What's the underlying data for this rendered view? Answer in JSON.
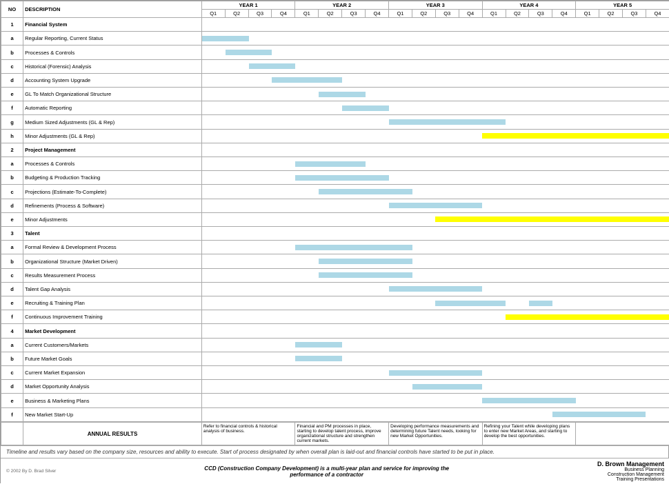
{
  "years": [
    "YEAR 1",
    "YEAR 2",
    "YEAR 3",
    "YEAR 4",
    "YEAR 5"
  ],
  "quarters": [
    "Q1",
    "Q2",
    "Q3",
    "Q4"
  ],
  "columns": {
    "no_label": "NO",
    "desc_label": "DESCRIPTION"
  },
  "sections": [
    {
      "no": "1",
      "title": "Financial System",
      "items": [
        {
          "id": "a",
          "desc": "Regular Reporting, Current Status",
          "bars": [
            {
              "q": 1,
              "w": 2,
              "color": "blue"
            }
          ]
        },
        {
          "id": "b",
          "desc": "Processes & Controls",
          "bars": [
            {
              "q": 2,
              "w": 2,
              "color": "blue"
            }
          ]
        },
        {
          "id": "c",
          "desc": "Historical (Forensic) Analysis",
          "bars": [
            {
              "q": 3,
              "w": 2,
              "color": "blue"
            }
          ]
        },
        {
          "id": "d",
          "desc": "Accounting System Upgrade",
          "bars": [
            {
              "q": 4,
              "w": 3,
              "color": "blue"
            }
          ]
        },
        {
          "id": "e",
          "desc": "GL To Match Organizational Structure",
          "bars": [
            {
              "q": 6,
              "w": 2,
              "color": "blue"
            }
          ]
        },
        {
          "id": "f",
          "desc": "Automatic Reporting",
          "bars": [
            {
              "q": 7,
              "w": 2,
              "color": "blue"
            }
          ]
        },
        {
          "id": "g",
          "desc": "Medium Sized Adjustments (GL & Rep)",
          "bars": [
            {
              "q": 9,
              "w": 5,
              "color": "blue"
            }
          ]
        },
        {
          "id": "h",
          "desc": "Minor Adjustments (GL & Rep)",
          "bars": [
            {
              "q": 13,
              "w": 8,
              "color": "yellow"
            }
          ]
        }
      ]
    },
    {
      "no": "2",
      "title": "Project Management",
      "items": [
        {
          "id": "a",
          "desc": "Processes & Controls",
          "bars": [
            {
              "q": 5,
              "w": 3,
              "color": "blue"
            }
          ]
        },
        {
          "id": "b",
          "desc": "Budgeting & Production Tracking",
          "bars": [
            {
              "q": 5,
              "w": 4,
              "color": "blue"
            }
          ]
        },
        {
          "id": "c",
          "desc": "Projections (Estimate-To-Complete)",
          "bars": [
            {
              "q": 6,
              "w": 4,
              "color": "blue"
            }
          ]
        },
        {
          "id": "d",
          "desc": "Refinements (Process & Software)",
          "bars": [
            {
              "q": 9,
              "w": 4,
              "color": "blue"
            }
          ]
        },
        {
          "id": "e",
          "desc": "Minor Adjustments",
          "bars": [
            {
              "q": 11,
              "w": 10,
              "color": "yellow"
            }
          ]
        }
      ]
    },
    {
      "no": "3",
      "title": "Talent",
      "items": [
        {
          "id": "a",
          "desc": "Formal Review & Development Process",
          "bars": [
            {
              "q": 5,
              "w": 5,
              "color": "blue"
            }
          ]
        },
        {
          "id": "b",
          "desc": "Organizational Structure (Market Driven)",
          "bars": [
            {
              "q": 6,
              "w": 4,
              "color": "blue"
            }
          ]
        },
        {
          "id": "c",
          "desc": "Results Measurement Process",
          "bars": [
            {
              "q": 6,
              "w": 4,
              "color": "blue"
            }
          ]
        },
        {
          "id": "d",
          "desc": "Talent Gap Analysis",
          "bars": [
            {
              "q": 9,
              "w": 4,
              "color": "blue"
            }
          ]
        },
        {
          "id": "e",
          "desc": "Recruiting & Training Plan",
          "bars": [
            {
              "q": 11,
              "w": 3,
              "color": "blue"
            },
            {
              "q": 15,
              "w": 1,
              "color": "blue"
            }
          ]
        },
        {
          "id": "f",
          "desc": "Continuous Improvement Training",
          "bars": [
            {
              "q": 14,
              "w": 7,
              "color": "yellow"
            }
          ]
        }
      ]
    },
    {
      "no": "4",
      "title": "Market Development",
      "items": [
        {
          "id": "a",
          "desc": "Current Customers/Markets",
          "bars": [
            {
              "q": 5,
              "w": 2,
              "color": "blue"
            }
          ]
        },
        {
          "id": "b",
          "desc": "Future Market Goals",
          "bars": [
            {
              "q": 5,
              "w": 2,
              "color": "blue"
            }
          ]
        },
        {
          "id": "c",
          "desc": "Current Market Expansion",
          "bars": [
            {
              "q": 9,
              "w": 4,
              "color": "blue"
            }
          ]
        },
        {
          "id": "d",
          "desc": "Market Opportunity Analysis",
          "bars": [
            {
              "q": 10,
              "w": 3,
              "color": "blue"
            }
          ]
        },
        {
          "id": "e",
          "desc": "Business & Marketing Plans",
          "bars": [
            {
              "q": 13,
              "w": 4,
              "color": "blue"
            }
          ]
        },
        {
          "id": "f",
          "desc": "New Market Start-Up",
          "bars": [
            {
              "q": 16,
              "w": 4,
              "color": "blue"
            }
          ]
        }
      ]
    }
  ],
  "annual_results": {
    "label": "ANNUAL RESULTS",
    "year1": "Refer to financial controls & historical analysis of business.",
    "year2": "Financial and PM processes in place, starting to develop talent process, improve organizational structure and strengthen current markets.",
    "year3": "Developing performance measurements and determining future Talent needs, looking for new Market Opportunities.",
    "year4": "Refining your Talent while developing plans to enter new Market Areas, and starting to develop the best opportunities.",
    "year5": ""
  },
  "footer": {
    "note": "Timeline and results vary based on the company size, resources and ability to execute.  Start of process designated by when overall plan is laid-out and financial controls have started to be put in place.",
    "copyright": "© 2002 By D. Brad Silver",
    "center_line1": "CCD (Construction Company Development) is a multi-year plan and service for improving the",
    "center_line2": "performance of a contractor",
    "company_name": "D. Brown Management",
    "company_line2": "Business Planning",
    "company_line3": "Construction Management",
    "company_line4": "Training Presentations"
  }
}
